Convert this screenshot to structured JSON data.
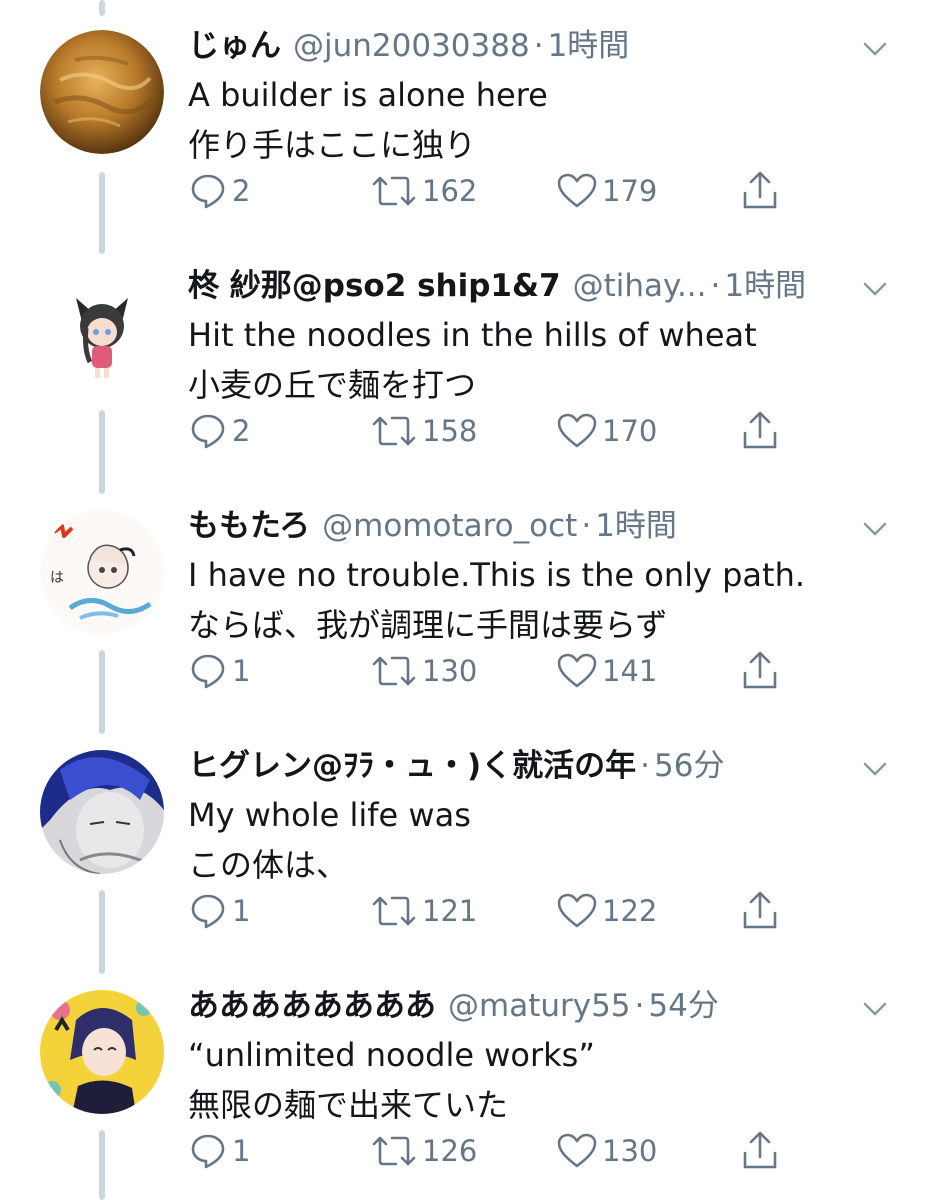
{
  "tweets": [
    {
      "name": "じゅん",
      "handle": "@jun20030388",
      "dot": "·",
      "time": "1時間",
      "lines": [
        "A builder is alone here",
        "作り手はここに独り"
      ],
      "replies": "2",
      "retweets": "162",
      "likes": "179",
      "avatar": "venus-planet-avatar"
    },
    {
      "name": "柊 紗那@pso2 ship1&7",
      "handle": "@tihay...",
      "dot": "·",
      "time": "1時間",
      "lines": [
        "Hit the noodles in the hills of wheat",
        "小麦の丘で麺を打つ"
      ],
      "replies": "2",
      "retweets": "158",
      "likes": "170",
      "avatar": "catgirl-chibi-avatar"
    },
    {
      "name": "ももたろ",
      "handle": "@momotaro_oct",
      "dot": "·",
      "time": "1時間",
      "lines": [
        "I have no trouble.This is the only path.",
        "ならば、我が調理に手間は要らず"
      ],
      "replies": "1",
      "retweets": "130",
      "likes": "141",
      "avatar": "anime-sketch-avatar"
    },
    {
      "name": "ヒグレン@ｦﾗ・ュ・)く就活の年",
      "handle": "",
      "dot": "·",
      "time": "56分",
      "lines": [
        "My whole life was",
        "この体は、"
      ],
      "replies": "1",
      "retweets": "121",
      "likes": "122",
      "avatar": "blue-hair-anime-avatar"
    },
    {
      "name": "ああああああああ",
      "handle": "@matury55",
      "dot": "·",
      "time": "54分",
      "lines": [
        "“unlimited noodle works”",
        "無限の麺で出来ていた"
      ],
      "replies": "1",
      "retweets": "126",
      "likes": "130",
      "avatar": "idol-anime-avatar"
    }
  ],
  "icons": {
    "reply": "reply-icon",
    "retweet": "retweet-icon",
    "like": "heart-icon",
    "share": "share-icon",
    "caret": "chevron-down-icon"
  },
  "colors": {
    "text": "#14171a",
    "secondary": "#657786",
    "thread_line": "#ccd6dd",
    "background": "#ffffff"
  }
}
